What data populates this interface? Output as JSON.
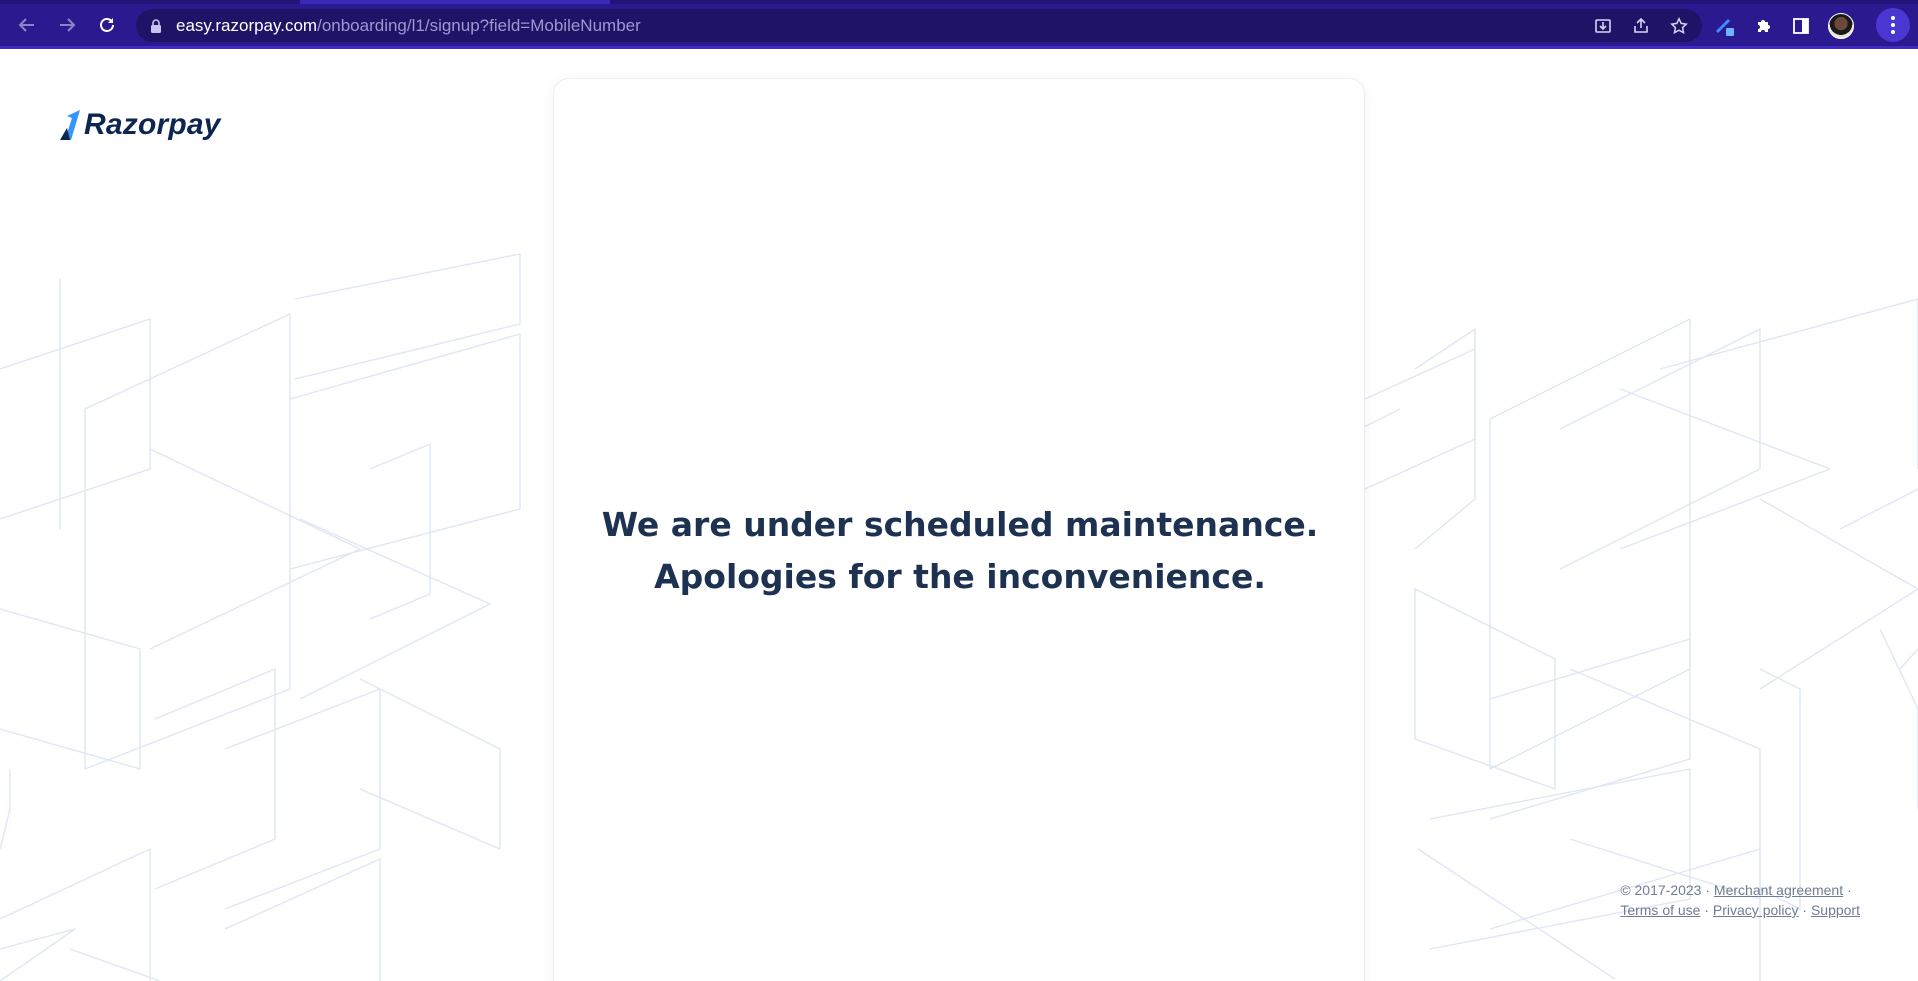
{
  "browser": {
    "url_host": "easy.razorpay.com",
    "url_path": "/onboarding/l1/signup?field=MobileNumber",
    "icons": {
      "back": "arrow-left-icon",
      "forward": "arrow-right-icon",
      "reload": "reload-icon",
      "lock": "lock-icon",
      "install": "install-icon",
      "share": "share-icon",
      "bookmark": "star-icon",
      "extension_pen": "pen-extension-icon",
      "extensions": "puzzle-icon",
      "side_panel": "side-panel-icon",
      "profile": "avatar",
      "menu": "kebab-menu-icon"
    },
    "colors": {
      "chrome": "#2b1a8f",
      "omnibox": "#1f1367"
    }
  },
  "brand": {
    "name": "Razorpay",
    "color": "#0c2651",
    "accent": "#3395ff"
  },
  "main": {
    "line1": "We are under scheduled maintenance.",
    "line2": "Apologies for the inconvenience."
  },
  "footer": {
    "copyright": "© 2017-2023 ·",
    "merchant_agreement": "Merchant agreement",
    "terms": "Terms of use",
    "privacy": "Privacy policy",
    "support": "Support",
    "dot": "·"
  }
}
